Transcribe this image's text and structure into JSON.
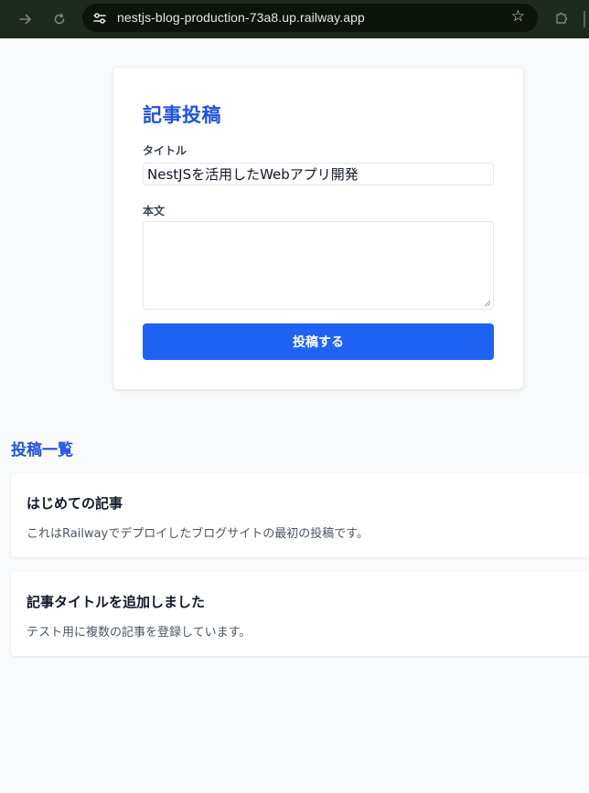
{
  "browser": {
    "url": "nestjs-blog-production-73a8.up.railway.app",
    "icons": {
      "forward": "arrow-right-icon",
      "reload": "reload-icon",
      "site_info": "tune-icon",
      "bookmark": "star-icon",
      "extensions": "puzzle-icon"
    }
  },
  "form": {
    "heading": "記事投稿",
    "title_label": "タイトル",
    "title_value": "NestJSを活用したWebアプリ開発",
    "body_label": "本文",
    "body_value": "",
    "submit_label": "投稿する"
  },
  "posts": {
    "heading": "投稿一覧",
    "items": [
      {
        "title": "はじめての記事",
        "body": "これはRailwayでデプロイしたブログサイトの最初の投稿です。"
      },
      {
        "title": "記事タイトルを追加しました",
        "body": "テスト用に複数の記事を登録しています。"
      }
    ]
  },
  "colors": {
    "accent": "#2052e0",
    "button": "#1f63f5",
    "chrome": "#1f2a1e",
    "page_bg": "#f9fafb"
  }
}
